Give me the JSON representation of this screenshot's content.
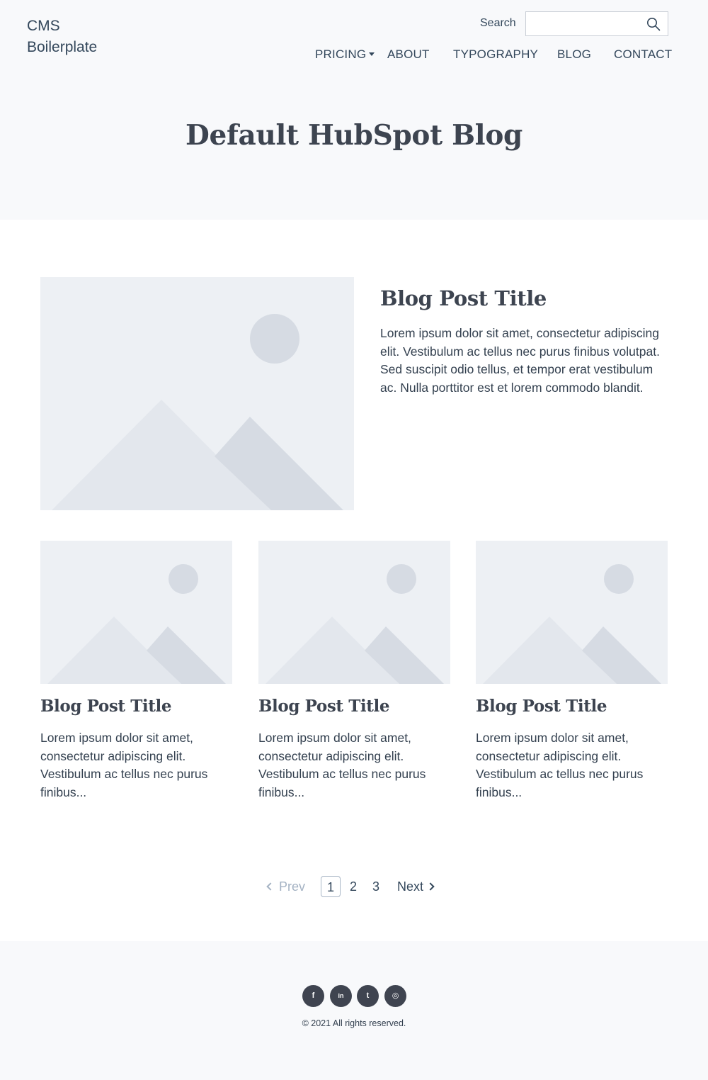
{
  "header": {
    "logo": "CMS Boilerplate",
    "search": {
      "label": "Search",
      "value": "",
      "placeholder": ""
    },
    "nav": [
      {
        "label": "PRICING",
        "has_dropdown": true
      },
      {
        "label": "ABOUT"
      },
      {
        "label": "TYPOGRAPHY"
      },
      {
        "label": "BLOG"
      },
      {
        "label": "CONTACT"
      }
    ]
  },
  "hero": {
    "title": "Default HubSpot Blog"
  },
  "featured_post": {
    "title": "Blog Post Title",
    "excerpt": "Lorem ipsum dolor sit amet, consectetur adipiscing elit. Vestibulum ac tellus nec purus finibus volutpat. Sed suscipit odio tellus, et tempor erat vestibulum ac. Nulla porttitor est et lorem commodo blandit.",
    "image": "image-placeholder-icon"
  },
  "posts": [
    {
      "title": "Blog Post Title",
      "excerpt": "Lorem ipsum dolor sit amet, consectetur adipiscing elit. Vestibulum ac tellus nec purus finibus...",
      "image": "image-placeholder-icon"
    },
    {
      "title": "Blog Post Title",
      "excerpt": "Lorem ipsum dolor sit amet, consectetur adipiscing elit. Vestibulum ac tellus nec purus finibus...",
      "image": "image-placeholder-icon"
    },
    {
      "title": "Blog Post Title",
      "excerpt": "Lorem ipsum dolor sit amet, consectetur adipiscing elit. Vestibulum ac tellus nec purus finibus...",
      "image": "image-placeholder-icon"
    }
  ],
  "pagination": {
    "prev": "Prev",
    "pages": [
      "1",
      "2",
      "3"
    ],
    "current": "1",
    "next": "Next"
  },
  "footer": {
    "socials": [
      {
        "icon": "facebook-icon",
        "glyph": "f"
      },
      {
        "icon": "linkedin-icon",
        "glyph": "in"
      },
      {
        "icon": "twitter-icon",
        "glyph": "t"
      },
      {
        "icon": "instagram-icon",
        "glyph": "◎"
      }
    ],
    "copyright": "© 2021 All rights reserved."
  },
  "colors": {
    "text": "#33475b",
    "heading": "#3d4450",
    "hero_bg": "#f8f9fb",
    "placeholder_bg": "#edf0f4",
    "placeholder_shape_light": "#e3e7ed",
    "placeholder_shape_dark": "#d6dbe3",
    "social_bg": "#3f4450"
  }
}
